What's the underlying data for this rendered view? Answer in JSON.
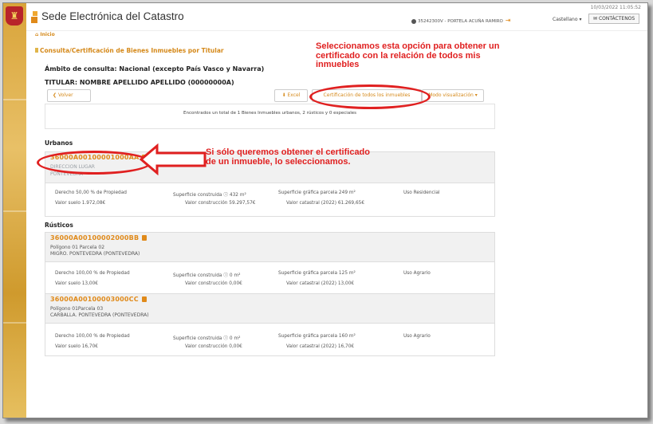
{
  "header": {
    "site_title": "Sede Electrónica del Catastro",
    "datetime": "10/03/2022 11:05:52",
    "user": "35242300V - PORTELA ACUÑA RAMIRO",
    "language": "Castellano",
    "language_arrow": "▾",
    "contact_label": "CONTÁCTENOS",
    "contact_icon": "✉"
  },
  "breadcrumb": {
    "home": "Inicio"
  },
  "page": {
    "title": "Consulta/Certificación de Bienes Inmuebles por Titular",
    "scope": "Ámbito de consulta: Nacional (excepto País Vasco y Navarra)",
    "titular": "TITULAR: NOMBRE APELLIDO APELLIDO (00000000A)"
  },
  "toolbar": {
    "back_label": "Volver",
    "back_icon": "❮",
    "excel_label": "Excel",
    "excel_icon": "⬇",
    "cert_label": "Certificación de todos los inmuebles",
    "mode_label": "Modo visualización",
    "mode_arrow": "▾"
  },
  "summary": "Encontrados un total de 1 Bienes Inmuebles urbanos, 2 rústicos y 0 especiales",
  "sections": {
    "urbanos": "Urbanos",
    "rusticos": "Rústicos"
  },
  "properties": [
    {
      "ref": "36000A00100001000AA",
      "line1": "DIRECCION LUGAR",
      "line2": "PONTEVEDRA",
      "derecho": "Derecho 50,00 % de Propiedad",
      "valor_suelo": "Valor suelo 1.972,08€",
      "sup_construida": "Superficie construida ⓘ 432 m²",
      "valor_construccion": "Valor construcción 59.297,57€",
      "sup_grafica": "Superficie gráfica parcela 249 m²",
      "valor_catastral": "Valor catastral (2022) 61.269,65€",
      "uso": "Uso Residencial"
    },
    {
      "ref": "36000A00100002000BB",
      "line1": "Polígono 01 Parcela 02",
      "line2": "MIGRO. PONTEVEDRA (PONTEVEDRA)",
      "derecho": "Derecho 100,00 % de Propiedad",
      "valor_suelo": "Valor suelo 13,00€",
      "sup_construida": "Superficie construida ⓘ 0 m²",
      "valor_construccion": "Valor construcción 0,00€",
      "sup_grafica": "Superficie gráfica parcela 125 m²",
      "valor_catastral": "Valor catastral (2022) 13,00€",
      "uso": "Uso Agrario"
    },
    {
      "ref": "36000A00100003000CC",
      "line1": "Polígono 01Parcela 03",
      "line2": "CARBALLA. PONTEVEDRA (PONTEVEDRA)",
      "derecho": "Derecho 100,00 % de Propiedad",
      "valor_suelo": "Valor suelo 16,70€",
      "sup_construida": "Superficie construida ⓘ 0 m²",
      "valor_construccion": "Valor construcción 0,00€",
      "sup_grafica": "Superficie gráfica parcela 160 m²",
      "valor_catastral": "Valor catastral (2022) 16,70€",
      "uso": "Uso Agrario"
    }
  ],
  "annotations": {
    "top": "Seleccionamos esta opción para obtener un certificado con la relación de todos mis inmuebles",
    "middle": "Si sólo queremos obtener el certificado de un inmueble, lo seleccionamos."
  },
  "colors": {
    "accent": "#e08a1a",
    "annotation": "#e02020"
  }
}
